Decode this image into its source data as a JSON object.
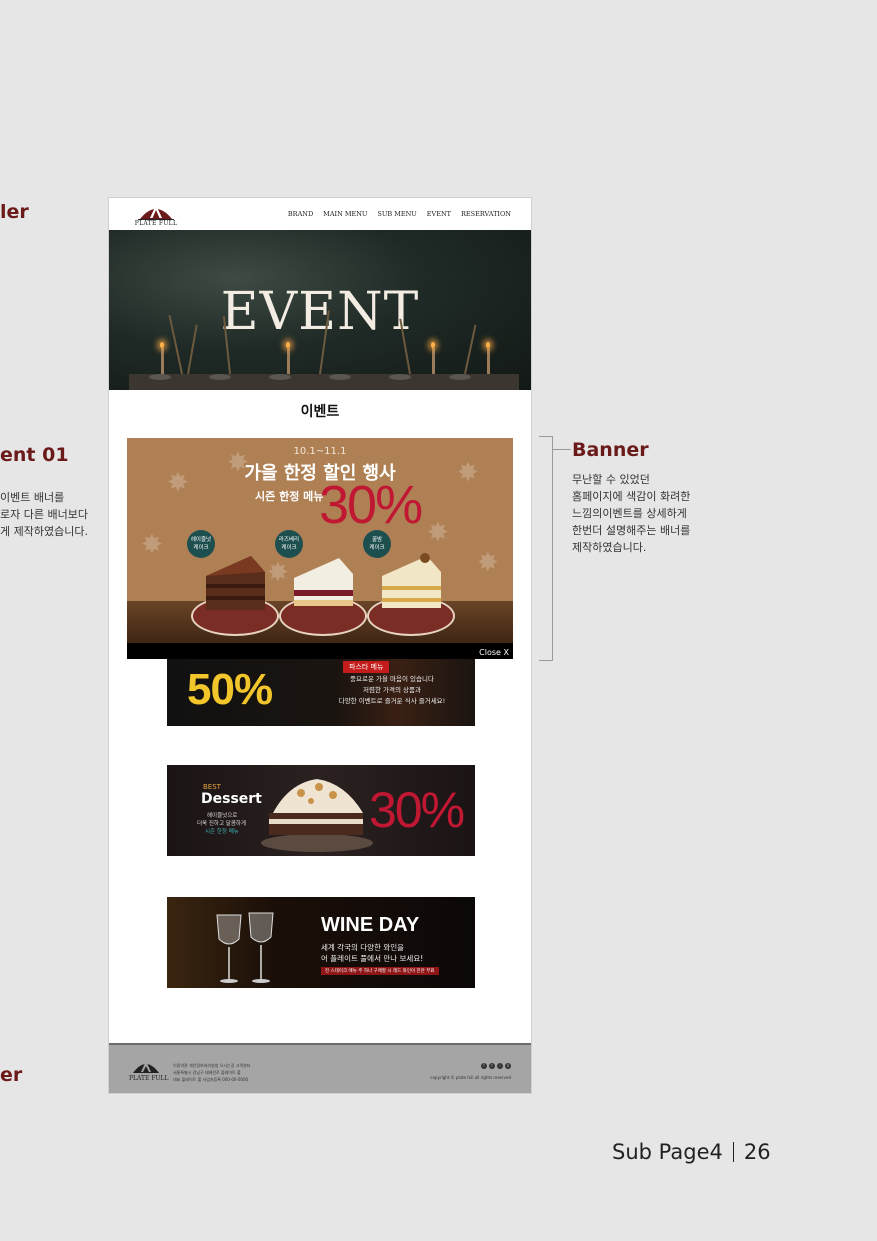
{
  "left_labels": {
    "header": "ler",
    "event_heading": "ent 01",
    "event_desc": [
      "이벤트 배너를",
      "로자 다른 배너보다",
      "게 제작하였습니다."
    ],
    "footer": "er"
  },
  "site": {
    "logo_text": "PLATE FULL",
    "nav": [
      "BRAND",
      "MAIN MENU",
      "SUB MENU",
      "EVENT",
      "RESERVATION"
    ],
    "hero_title": "EVENT",
    "section_title": "이벤트"
  },
  "main_banner": {
    "date": "10.1~11.1",
    "headline": "가을 한정 할인 행사",
    "subline": "시즌 한정 메뉴",
    "percent": "30%",
    "badges": [
      "헤이즐넛\n케이크",
      "라즈베리\n케이크",
      "꿀밤\n케이크"
    ],
    "close": "Close  X"
  },
  "banner_pasta": {
    "percent": "50%",
    "tag": "파스타 메뉴",
    "lines": [
      "풍요로운 가을 마음이 있습니다",
      "저렴한 가격의 상품과",
      "다양한 이벤트로 즐거운 식사 즐거세요!"
    ]
  },
  "banner_dessert": {
    "best": "BEST",
    "title": "Dessert",
    "line1": "헤이즐넛으로",
    "line2": "더욱 진하고 달콤하게",
    "line3": "시즌 한정 메뉴",
    "percent": "30%"
  },
  "banner_wine": {
    "title": "WINE DAY",
    "line1": "세계 각국의 다양한 와인을",
    "line2": "어 플레이트 풀에서 만나 보세요!",
    "strip": "전 스테이크 메뉴 주 하나 구매할 시 레드 와인이 한잔 무료"
  },
  "site_footer": {
    "logo_text": "PLATE FULL",
    "links": "이용약관  개인정보처리방침  오시는길  고객센터",
    "addr1": "서울특별시 강남구 테헤란로 플레이트 풀",
    "addr2": "대표 플레이트 풀 사업자등록 000-00-0000",
    "copyright": "copyright © plate full all rights reserved"
  },
  "annotation": {
    "title": "Banner",
    "lines": [
      "무난할 수 있었던",
      "홈페이지에 색감이 화려한",
      "느낌의이벤트를 상세하게",
      "한번더 설명해주는 배너를",
      "제작하였습니다."
    ]
  },
  "page_footer": {
    "section": "Sub Page4",
    "number": "26"
  },
  "colors": {
    "accent": "#6b1a1a",
    "banner_red": "#c01733",
    "pasta_yellow": "#f2c62a"
  }
}
